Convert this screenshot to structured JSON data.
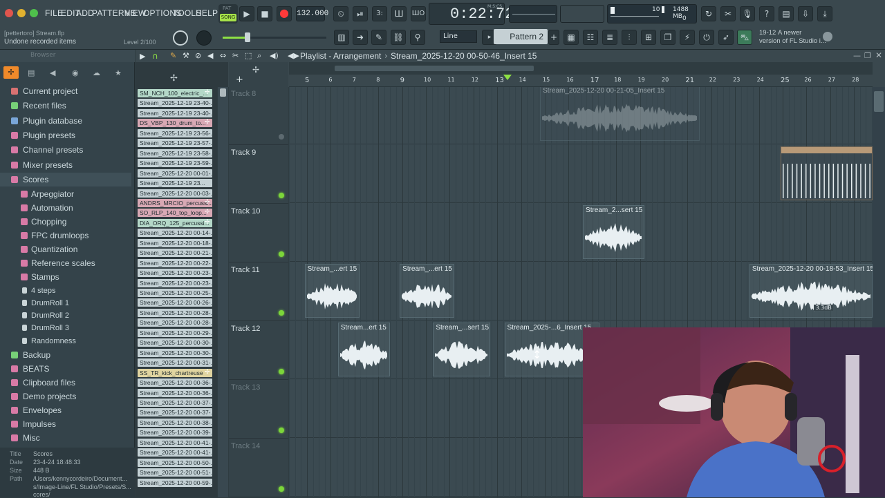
{
  "menu": [
    "FILE",
    "EDIT",
    "ADD",
    "PATTERNS",
    "VIEW",
    "OPTIONS",
    "TOOLS",
    "HELP"
  ],
  "transport": {
    "mode_pat": "PAT",
    "mode_song": "SONG",
    "tempo": "132.000",
    "time": "0:22:72",
    "time_unit": "M:S:CS",
    "cpu_left": "10",
    "mem": "1488 MB",
    "cpu_right": "0"
  },
  "hint_bar": {
    "file": "[pettertoro] Stream.flp",
    "status": "Undone  recorded items",
    "level": "Level 2/100"
  },
  "toolbar2": {
    "snap": "Line",
    "pattern": "Pattern 2"
  },
  "news": {
    "date": "19-12",
    "text1": "A newer",
    "text2": "version of FL Studio i..."
  },
  "playlist": {
    "title": "Playlist - Arrangement",
    "path": "Stream_2025-12-20 00-50-46_Insert 15"
  },
  "browser": {
    "title": "Browser",
    "items": [
      {
        "label": "Current project",
        "color": "#d97272"
      },
      {
        "label": "Recent files",
        "color": "#78d078"
      },
      {
        "label": "Plugin database",
        "color": "#7aa6d8"
      },
      {
        "label": "Plugin presets",
        "color": "#d87aa6"
      },
      {
        "label": "Channel presets",
        "color": "#d87aa6"
      },
      {
        "label": "Mixer presets",
        "color": "#d87aa6"
      },
      {
        "label": "Scores",
        "color": "#d87aa6"
      }
    ],
    "sub": [
      "Arpeggiator",
      "Automation",
      "Chopping",
      "FPC drumloops",
      "Quantization",
      "Reference scales",
      "Stamps"
    ],
    "files": [
      "4 steps",
      "DrumRoll 1",
      "DrumRoll 2",
      "DrumRoll 3",
      "Randomness"
    ],
    "more": [
      {
        "label": "Backup",
        "color": "#78d078"
      },
      {
        "label": "BEATS",
        "color": "#d87aa6"
      },
      {
        "label": "Clipboard files",
        "color": "#d87aa6"
      },
      {
        "label": "Demo projects",
        "color": "#d87aa6"
      },
      {
        "label": "Envelopes",
        "color": "#d87aa6"
      },
      {
        "label": "Impulses",
        "color": "#d87aa6"
      },
      {
        "label": "Misc",
        "color": "#d87aa6"
      }
    ]
  },
  "info": {
    "title_k": "Title",
    "title": "Scores",
    "date_k": "Date",
    "date": "23-4-24 18:48:33",
    "size_k": "Size",
    "size": "448 B",
    "path_k": "Path",
    "path1": "/Users/kennycordeiro/Document...",
    "path2": "s/Image-Line/FL Studio/Presets/S...",
    "path3": "cores/"
  },
  "channels": [
    {
      "name": "SM_NCH_100_electric_...",
      "kind": "grn"
    },
    {
      "name": "Stream_2025-12-19 23-40-...",
      "kind": ""
    },
    {
      "name": "Stream_2025-12-19 23-40-...",
      "kind": ""
    },
    {
      "name": "DS_VBP_130_drum_to...",
      "kind": "red"
    },
    {
      "name": "Stream_2025-12-19 23-56-...",
      "kind": ""
    },
    {
      "name": "Stream_2025-12-19 23-57-...",
      "kind": ""
    },
    {
      "name": "Stream_2025-12-19 23-58-...",
      "kind": ""
    },
    {
      "name": "Stream_2025-12-19 23-59-...",
      "kind": ""
    },
    {
      "name": "Stream_2025-12-20 00-01-...",
      "kind": ""
    },
    {
      "name": "Stream_2025-12-19 23...",
      "kind": ""
    },
    {
      "name": "Stream_2025-12-20 00-03-...",
      "kind": ""
    },
    {
      "name": "ANDRS_MRCIO_percussi...",
      "kind": "red"
    },
    {
      "name": "SO_RLP_140_top_loop...",
      "kind": "red"
    },
    {
      "name": "DIA_ORQ_125_percussi...",
      "kind": "grn"
    },
    {
      "name": "Stream_2025-12-20 00-14-...",
      "kind": ""
    },
    {
      "name": "Stream_2025-12-20 00-18-...",
      "kind": ""
    },
    {
      "name": "Stream_2025-12-20 00-21-...",
      "kind": ""
    },
    {
      "name": "Stream_2025-12-20 00-22-...",
      "kind": ""
    },
    {
      "name": "Stream_2025-12-20 00-23-...",
      "kind": ""
    },
    {
      "name": "Stream_2025-12-20 00-23-...",
      "kind": ""
    },
    {
      "name": "Stream_2025-12-20 00-25-...",
      "kind": ""
    },
    {
      "name": "Stream_2025-12-20 00-26-...",
      "kind": ""
    },
    {
      "name": "Stream_2025-12-20 00-28-...",
      "kind": ""
    },
    {
      "name": "Stream_2025-12-20 00-28-...",
      "kind": ""
    },
    {
      "name": "Stream_2025-12-20 00-29-...",
      "kind": ""
    },
    {
      "name": "Stream_2025-12-20 00-30-...",
      "kind": ""
    },
    {
      "name": "Stream_2025-12-20 00-30-...",
      "kind": ""
    },
    {
      "name": "Stream_2025-12-20 00-31-...",
      "kind": ""
    },
    {
      "name": "SS_TR_kick_chartreuse",
      "kind": "yel"
    },
    {
      "name": "Stream_2025-12-20 00-36-...",
      "kind": ""
    },
    {
      "name": "Stream_2025-12-20 00-36-...",
      "kind": ""
    },
    {
      "name": "Stream_2025-12-20 00-37-...",
      "kind": ""
    },
    {
      "name": "Stream_2025-12-20 00-37-...",
      "kind": ""
    },
    {
      "name": "Stream_2025-12-20 00-38-...",
      "kind": ""
    },
    {
      "name": "Stream_2025-12-20 00-39-...",
      "kind": ""
    },
    {
      "name": "Stream_2025-12-20 00-41-...",
      "kind": ""
    },
    {
      "name": "Stream_2025-12-20 00-41-...",
      "kind": ""
    },
    {
      "name": "Stream_2025-12-20 00-50-...",
      "kind": ""
    },
    {
      "name": "Stream_2025-12-20 00-51-...",
      "kind": ""
    },
    {
      "name": "Stream_2025-12-20 00-59-...",
      "kind": ""
    }
  ],
  "ruler": [
    "5",
    "6",
    "7",
    "8",
    "9",
    "10",
    "11",
    "12",
    "13",
    "14",
    "15",
    "16",
    "17",
    "18",
    "19",
    "20",
    "21",
    "22",
    "23",
    "24",
    "25",
    "26",
    "27",
    "28"
  ],
  "tracks": [
    "Track 8",
    "Track 9",
    "Track 10",
    "Track 11",
    "Track 12",
    "Track 13",
    "Track 14"
  ],
  "clips": [
    {
      "label": "Stream_2025-12-20 00-21-05_Insert 15",
      "lane": 0,
      "start": 10.8,
      "len": 6.7,
      "muted": true
    },
    {
      "label": "",
      "lane": 1,
      "start": 20.9,
      "len": 8,
      "muted": false,
      "pattern": true
    },
    {
      "label": "Stream_2...sert 15",
      "lane": 2,
      "start": 12.6,
      "len": 2.6,
      "muted": false
    },
    {
      "label": "Stream_...ert 15",
      "lane": 3,
      "start": 0.9,
      "len": 2.3,
      "muted": false
    },
    {
      "label": "Stream_...ert 15",
      "lane": 3,
      "start": 4.9,
      "len": 2.3,
      "muted": false
    },
    {
      "label": "Stream_2025-12-20 00-18-53_Insert 15",
      "lane": 3,
      "start": 19.6,
      "len": 9,
      "muted": false,
      "vol": "3.3dB"
    },
    {
      "label": "Stream...ert 15",
      "lane": 4,
      "start": 2.3,
      "len": 2.2,
      "muted": false
    },
    {
      "label": "Stream_...sert 15",
      "lane": 4,
      "start": 6.3,
      "len": 2.4,
      "muted": false
    },
    {
      "label": "Stream_2025-...6_Insert 15",
      "lane": 4,
      "start": 9.3,
      "len": 4,
      "muted": false
    }
  ]
}
